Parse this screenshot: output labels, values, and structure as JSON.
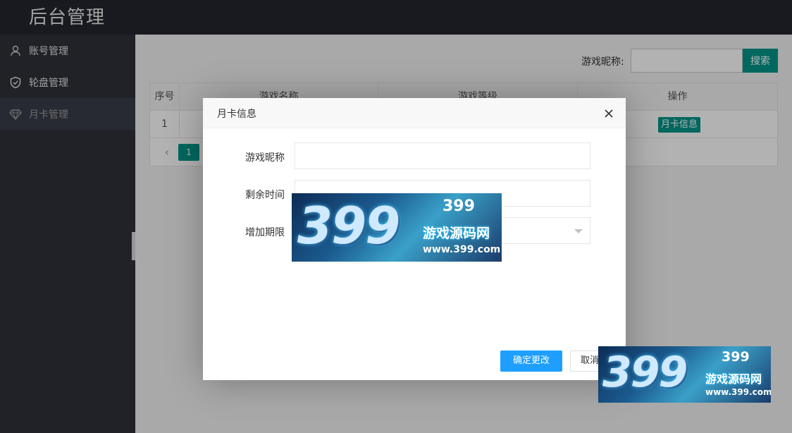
{
  "header": {
    "title": "后台管理"
  },
  "sidebar": {
    "items": [
      {
        "label": "账号管理",
        "icon": "user-icon"
      },
      {
        "label": "轮盘管理",
        "icon": "shield-check-icon"
      },
      {
        "label": "月卡管理",
        "icon": "diamond-icon",
        "active": true
      }
    ]
  },
  "search": {
    "label": "游戏昵称:",
    "value": "",
    "button": "搜索"
  },
  "table": {
    "columns": [
      "序号",
      "游戏名称",
      "游戏等级",
      "操作"
    ],
    "rows": [
      {
        "index": "1",
        "action": "月卡信息"
      }
    ],
    "pagination": {
      "current": "1"
    }
  },
  "dialog": {
    "title": "月卡信息",
    "fields": [
      {
        "label": "游戏昵称",
        "value": ""
      },
      {
        "label": "剩余时间",
        "value": ""
      },
      {
        "label": "增加期限",
        "value": ""
      }
    ],
    "confirm": "确定更改",
    "cancel": "取消"
  },
  "watermark": {
    "number": "399",
    "title": "399",
    "subtitle": "游戏源码网",
    "url": "www.399.com"
  },
  "colors": {
    "primary": "#009688",
    "confirm": "#1e9fff",
    "header": "#23262e",
    "sidebar": "#2f3139"
  }
}
